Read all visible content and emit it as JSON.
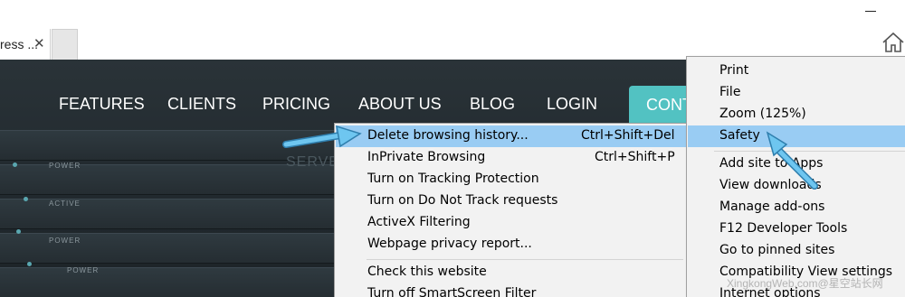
{
  "window": {
    "tab_title": "ress ...",
    "tab_close_glyph": "✕",
    "minimize_icon": "minimize-icon",
    "home_icon": "home-icon"
  },
  "site": {
    "nav": [
      "FEATURES",
      "CLIENTS",
      "PRICING",
      "ABOUT US",
      "BLOG",
      "LOGIN"
    ],
    "nav_active": "CONT",
    "nav_active_color": "#52c2c2",
    "rack_labels": [
      "POWER",
      "ACTIVE",
      "POWER",
      "POWER"
    ],
    "server_label": "SERVE"
  },
  "submenu": {
    "items": [
      {
        "label": "Delete browsing history...",
        "shortcut": "Ctrl+Shift+Del",
        "highlighted": true
      },
      {
        "label": "InPrivate Browsing",
        "shortcut": "Ctrl+Shift+P"
      },
      {
        "label": "Turn on Tracking Protection",
        "shortcut": ""
      },
      {
        "label": "Turn on Do Not Track requests",
        "shortcut": ""
      },
      {
        "label": "ActiveX Filtering",
        "shortcut": ""
      },
      {
        "label": "Webpage privacy report...",
        "shortcut": ""
      },
      {
        "label": "Check this website",
        "shortcut": ""
      },
      {
        "label": "Turn off SmartScreen Filter",
        "shortcut": ""
      }
    ]
  },
  "tools_menu": {
    "items": [
      {
        "label": "Print"
      },
      {
        "label": "File"
      },
      {
        "label": "Zoom (125%)"
      },
      {
        "label": "Safety",
        "highlighted": true
      },
      {
        "label": "Add site to Apps"
      },
      {
        "label": "View downloads"
      },
      {
        "label": "Manage add-ons"
      },
      {
        "label": "F12 Developer Tools"
      },
      {
        "label": "Go to pinned sites"
      },
      {
        "label": "Compatibility View settings"
      },
      {
        "label": "Internet options"
      }
    ]
  },
  "highlight_color": "#99ccf3",
  "arrow_color": "#5bb8e8",
  "watermark": "XingkongWeb.com@星空站长网"
}
